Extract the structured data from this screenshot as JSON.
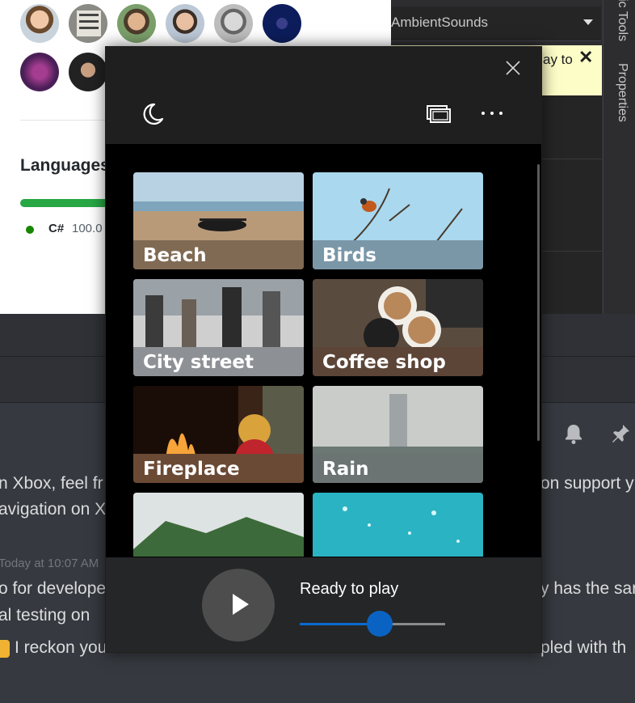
{
  "github": {
    "languages_heading": "Languages",
    "language": {
      "name": "C#",
      "percent": "100.0",
      "color": "#178600",
      "bar_color": "#28a745"
    }
  },
  "vs": {
    "dropdown_label": "AmbientSounds",
    "info_text": "ay to",
    "info_close": "✕",
    "side_tabs": [
      "ic Tools",
      "Properties"
    ]
  },
  "discord": {
    "lines": [
      {
        "id": "line1",
        "text": "n Xbox, feel fr"
      },
      {
        "id": "line1b",
        "text": "on support y"
      },
      {
        "id": "line2",
        "text": "avigation on X"
      },
      {
        "id": "time",
        "text": "Today at 10:07 AM"
      },
      {
        "id": "line3",
        "text": "o for develope"
      },
      {
        "id": "line3b",
        "text": "y has the sar"
      },
      {
        "id": "line4",
        "text": "al testing on"
      },
      {
        "id": "line5",
        "text": "I reckon you"
      },
      {
        "id": "line5b",
        "text": "pled with th"
      }
    ]
  },
  "ambie": {
    "close_icon": "close-icon",
    "sounds": [
      {
        "name": "Beach"
      },
      {
        "name": "Birds"
      },
      {
        "name": "City street"
      },
      {
        "name": "Coffee shop"
      },
      {
        "name": "Fireplace"
      },
      {
        "name": "Rain"
      },
      {
        "name": ""
      },
      {
        "name": ""
      }
    ],
    "player": {
      "status": "Ready to play",
      "volume": 0.55,
      "accent": "#0a63c2"
    }
  }
}
